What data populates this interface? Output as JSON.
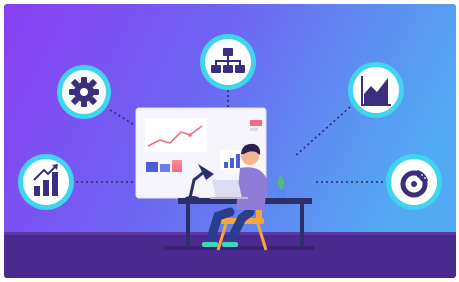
{
  "scene": {
    "colors": {
      "bg_left": "#8a3ff2",
      "bg_right": "#54a6f2",
      "floor": "#4a2a8e",
      "floor_dark": "#3b2175",
      "badge_ring": "#3fd5f0",
      "badge_fill": "#ffffff",
      "icon": "#3b2e7e",
      "board": "#f6f5fb",
      "shirt": "#8f7bd8",
      "pants": "#2b3d8f",
      "chair": "#f4a53c",
      "lamp": "#2b2f6a"
    },
    "icons": [
      "gear-icon",
      "org-chart-icon",
      "area-chart-icon",
      "bar-growth-icon",
      "donut-chart-icon"
    ]
  }
}
